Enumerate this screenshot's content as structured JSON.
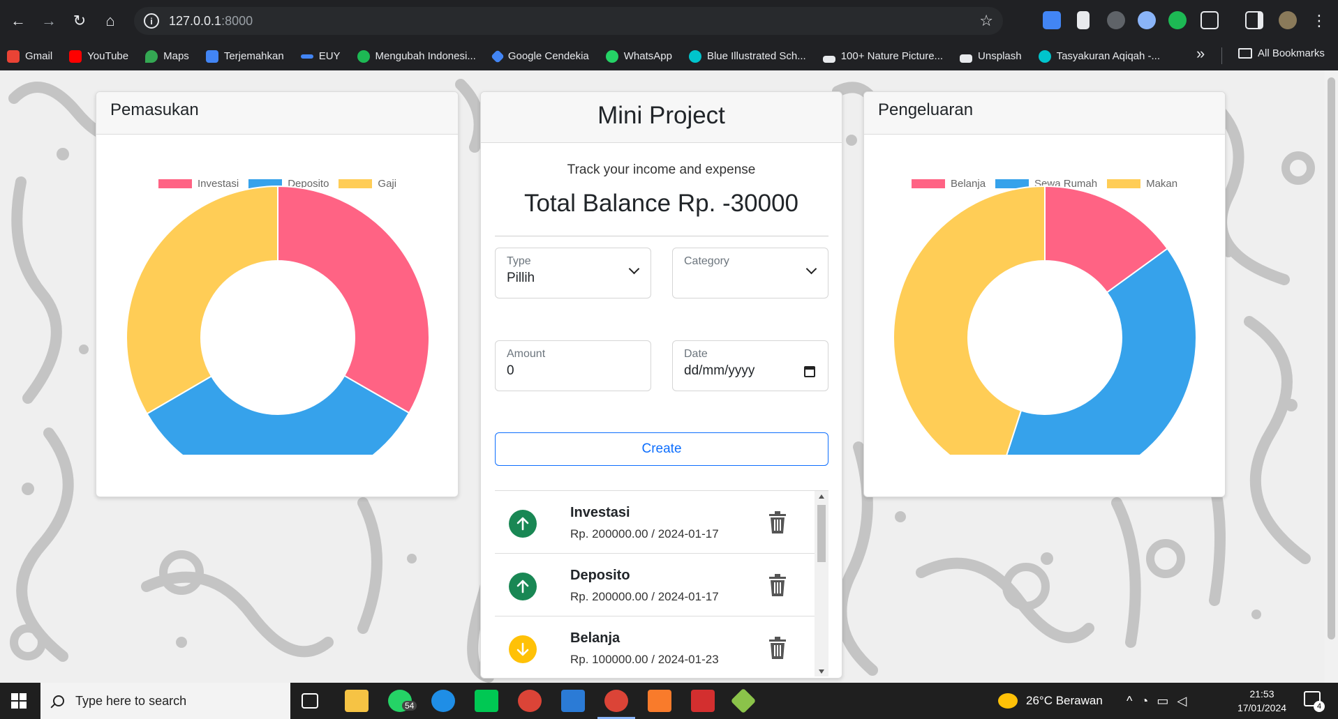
{
  "browser": {
    "url_host": "127.0.0.1",
    "url_port": ":8000",
    "bookmarks": [
      {
        "label": "Gmail",
        "color": "#ea4335"
      },
      {
        "label": "YouTube",
        "color": "#ff0000"
      },
      {
        "label": "Maps",
        "color": "#34a853"
      },
      {
        "label": "Terjemahkan",
        "color": "#4285f4"
      },
      {
        "label": "EUY",
        "color": "#4285f4"
      },
      {
        "label": "Mengubah Indonesi...",
        "color": "#1db954"
      },
      {
        "label": "Google Cendekia",
        "color": "#4285f4"
      },
      {
        "label": "WhatsApp",
        "color": "#25d366"
      },
      {
        "label": "Blue Illustrated Sch...",
        "color": "#00c4cc"
      },
      {
        "label": "100+ Nature Picture...",
        "color": "#ffffff"
      },
      {
        "label": "Unsplash",
        "color": "#ffffff"
      },
      {
        "label": "Tasyakuran Aqiqah -...",
        "color": "#00c4cc"
      }
    ],
    "all_bookmarks": "All Bookmarks"
  },
  "income_card": {
    "title": "Pemasukan"
  },
  "expense_card": {
    "title": "Pengeluaran"
  },
  "colors": {
    "pink": "#ff6384",
    "blue": "#36a2eb",
    "yellow": "#ffcd56",
    "green": "#198754",
    "amber": "#ffc107",
    "primary": "#0d6efd"
  },
  "chart_data": [
    {
      "type": "pie",
      "title": "",
      "categories": [
        "Investasi",
        "Deposito",
        "Gaji"
      ],
      "values": [
        33.3,
        33.3,
        33.4
      ],
      "legend": "top"
    },
    {
      "type": "pie",
      "title": "",
      "categories": [
        "Belanja",
        "Sewa Rumah",
        "Makan"
      ],
      "values": [
        15,
        40,
        45
      ],
      "legend": "top"
    }
  ],
  "main": {
    "title": "Mini Project",
    "subtitle": "Track your income and expense",
    "balance": "Total Balance Rp. -30000",
    "type_label": "Type",
    "type_value": "Pillih",
    "category_label": "Category",
    "category_value": "",
    "amount_label": "Amount",
    "amount_value": "0",
    "date_label": "Date",
    "date_placeholder": "dd/mm/yyyy",
    "create_label": "Create",
    "transactions": [
      {
        "name": "Investasi",
        "detail": "Rp. 200000.00 / 2024-01-17",
        "direction": "up"
      },
      {
        "name": "Deposito",
        "detail": "Rp. 200000.00 / 2024-01-17",
        "direction": "up"
      },
      {
        "name": "Belanja",
        "detail": "Rp. 100000.00 / 2024-01-23",
        "direction": "down"
      }
    ]
  },
  "taskbar": {
    "search_placeholder": "Type here to search",
    "whatsapp_badge": "54",
    "weather": "26°C  Berawan",
    "time": "21:53",
    "date": "17/01/2024",
    "notification_count": "4"
  }
}
